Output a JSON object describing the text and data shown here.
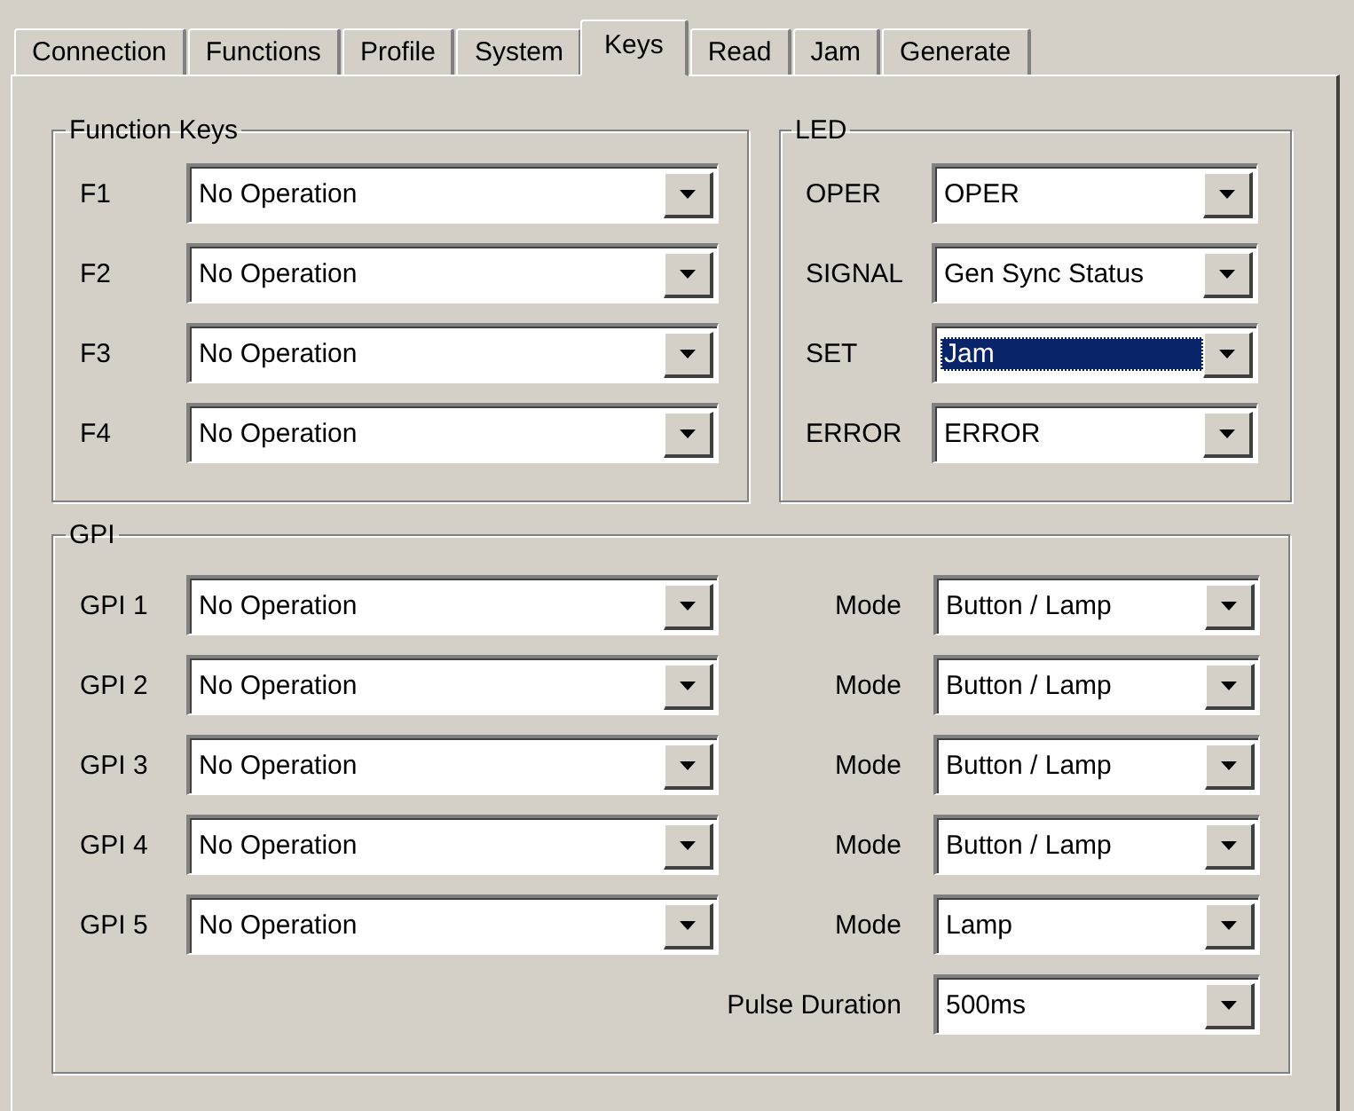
{
  "tabs": [
    {
      "label": "Connection",
      "selected": false
    },
    {
      "label": "Functions",
      "selected": false
    },
    {
      "label": "Profile",
      "selected": false
    },
    {
      "label": "System",
      "selected": false
    },
    {
      "label": "Keys",
      "selected": true
    },
    {
      "label": "Read",
      "selected": false
    },
    {
      "label": "Jam",
      "selected": false
    },
    {
      "label": "Generate",
      "selected": false
    }
  ],
  "function_keys": {
    "title": "Function Keys",
    "rows": [
      {
        "label": "F1",
        "value": "No Operation"
      },
      {
        "label": "F2",
        "value": "No Operation"
      },
      {
        "label": "F3",
        "value": "No Operation"
      },
      {
        "label": "F4",
        "value": "No Operation"
      }
    ]
  },
  "led": {
    "title": "LED",
    "rows": [
      {
        "label": "OPER",
        "value": "OPER",
        "highlighted": false
      },
      {
        "label": "SIGNAL",
        "value": "Gen Sync Status",
        "highlighted": false
      },
      {
        "label": "SET",
        "value": "Jam",
        "highlighted": true
      },
      {
        "label": "ERROR",
        "value": "ERROR",
        "highlighted": false
      }
    ]
  },
  "gpi": {
    "title": "GPI",
    "rows": [
      {
        "label": "GPI 1",
        "value": "No Operation",
        "mode_label": "Mode",
        "mode": "Button / Lamp"
      },
      {
        "label": "GPI 2",
        "value": "No Operation",
        "mode_label": "Mode",
        "mode": "Button / Lamp"
      },
      {
        "label": "GPI 3",
        "value": "No Operation",
        "mode_label": "Mode",
        "mode": "Button / Lamp"
      },
      {
        "label": "GPI 4",
        "value": "No Operation",
        "mode_label": "Mode",
        "mode": "Button / Lamp"
      },
      {
        "label": "GPI 5",
        "value": "No Operation",
        "mode_label": "Mode",
        "mode": "Lamp"
      }
    ],
    "pulse_duration": {
      "label": "Pulse Duration",
      "value": "500ms"
    }
  }
}
